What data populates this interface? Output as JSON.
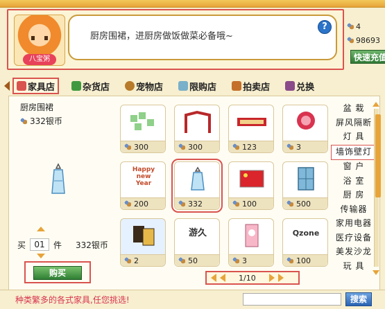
{
  "header": {
    "avatar_badge": "八宝粥",
    "speech": "厨房围裙，进厨房做饭做菜必备哦~",
    "help_label": "?"
  },
  "stats": {
    "count": "4",
    "coins": "98693"
  },
  "recharge_label": "快速充值",
  "tabs": [
    {
      "label": "家具店",
      "icon": "house-icon",
      "active": true
    },
    {
      "label": "杂货店",
      "icon": "leaf-icon"
    },
    {
      "label": "宠物店",
      "icon": "paw-icon"
    },
    {
      "label": "限购店",
      "icon": "vase-icon"
    },
    {
      "label": "拍卖店",
      "icon": "gavel-icon"
    },
    {
      "label": "兑换",
      "icon": "castle-icon"
    }
  ],
  "selected_item": {
    "name": "厨房围裙",
    "price": "332银币"
  },
  "purchase": {
    "qty_prefix": "买",
    "qty": "01",
    "qty_unit": "件",
    "total": "332银币",
    "buy_label": "购买"
  },
  "grid_items": [
    {
      "price": "300"
    },
    {
      "price": "300"
    },
    {
      "price": "123"
    },
    {
      "price": "3"
    },
    {
      "price": "200"
    },
    {
      "price": "332"
    },
    {
      "price": "100"
    },
    {
      "price": "500"
    },
    {
      "price": "2"
    },
    {
      "price": "50"
    },
    {
      "price": "3"
    },
    {
      "price": "100"
    }
  ],
  "grid_art_text": {
    "c5": "Happy new Year",
    "c10": "游久",
    "c12": "Qzone"
  },
  "categories": [
    "盆 栽",
    "屏风隔断",
    "灯 具",
    "墙饰壁灯",
    "窗 户",
    "浴 室",
    "厨 房",
    "传输器",
    "家用电器",
    "医疗设备",
    "美发沙龙",
    "玩 具"
  ],
  "pager": {
    "page": "1/10"
  },
  "footer": {
    "text": "种类繁多的各式家具,任您挑选!",
    "search_label": "搜索"
  }
}
